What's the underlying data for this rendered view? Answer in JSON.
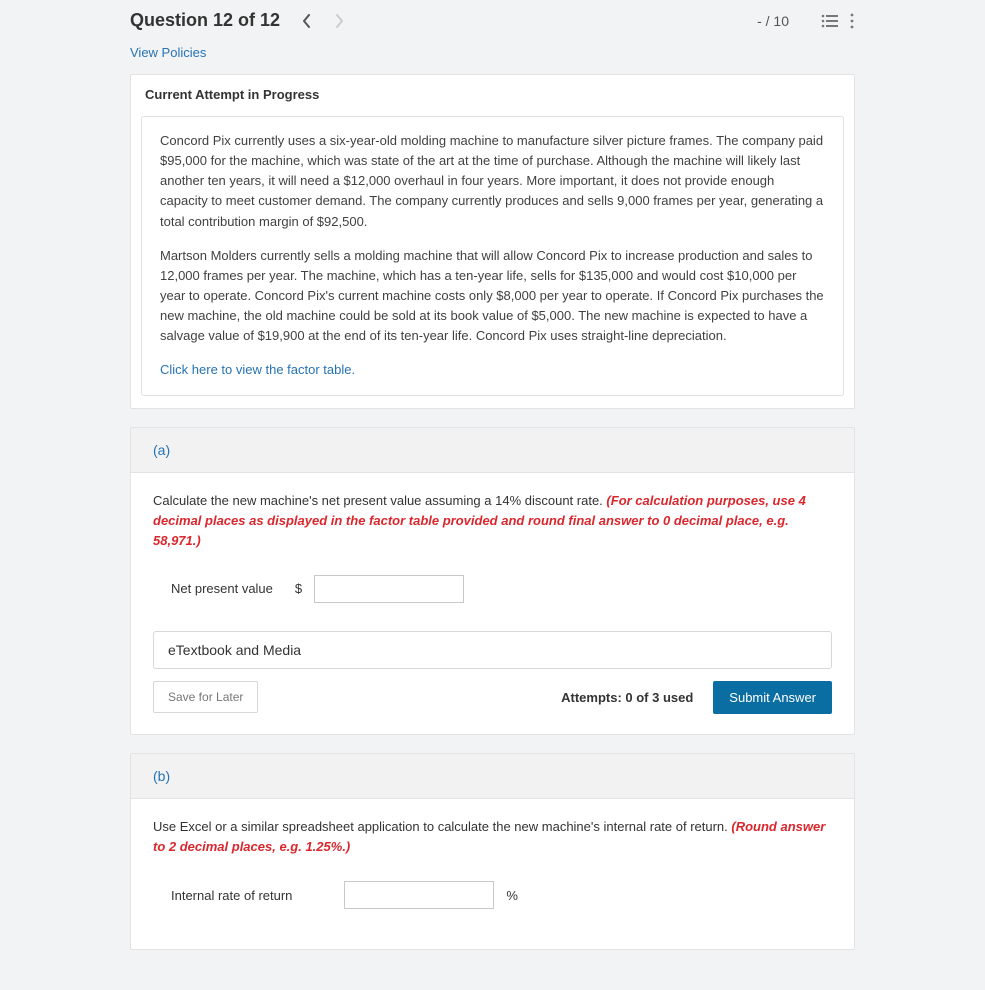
{
  "header": {
    "title": "Question 12 of 12",
    "score": "- / 10"
  },
  "links": {
    "view_policies": "View Policies",
    "factor_table": "Click here to view the factor table."
  },
  "attempt_heading": "Current Attempt in Progress",
  "problem": {
    "para1": "Concord Pix currently uses a six-year-old molding machine to manufacture silver picture frames. The company paid $95,000 for the machine, which was state of the art at the time of purchase. Although the machine will likely last another ten years, it will need a $12,000 overhaul in four years. More important, it does not provide enough capacity to meet customer demand. The company currently produces and sells 9,000 frames per year, generating a total contribution margin of $92,500.",
    "para2": "Martson Molders currently sells a molding machine that will allow Concord Pix to increase production and sales to 12,000 frames per year. The machine, which has a ten-year life, sells for $135,000 and would cost $10,000 per year to operate. Concord Pix's current machine costs only $8,000 per year to operate. If Concord Pix purchases the new machine, the old machine could be sold at its book value of $5,000. The new machine is expected to have a salvage value of $19,900 at the end of its ten-year life. Concord Pix uses straight-line depreciation."
  },
  "part_a": {
    "label": "(a)",
    "instr_plain": "Calculate the new machine's net present value assuming a 14% discount rate. ",
    "instr_red": "(For calculation purposes, use 4 decimal places as displayed in the factor table provided and round final answer to 0 decimal place, e.g. 58,971.)",
    "answer_label": "Net present value",
    "currency": "$",
    "etext": "eTextbook and Media",
    "save_label": "Save for Later",
    "attempts": "Attempts: 0 of 3 used",
    "submit_label": "Submit Answer"
  },
  "part_b": {
    "label": "(b)",
    "instr_plain": "Use Excel or a similar spreadsheet application to calculate the new machine's internal rate of return. ",
    "instr_red": "(Round answer to 2 decimal places, e.g. 1.25%.)",
    "answer_label": "Internal rate of return",
    "unit": "%"
  }
}
